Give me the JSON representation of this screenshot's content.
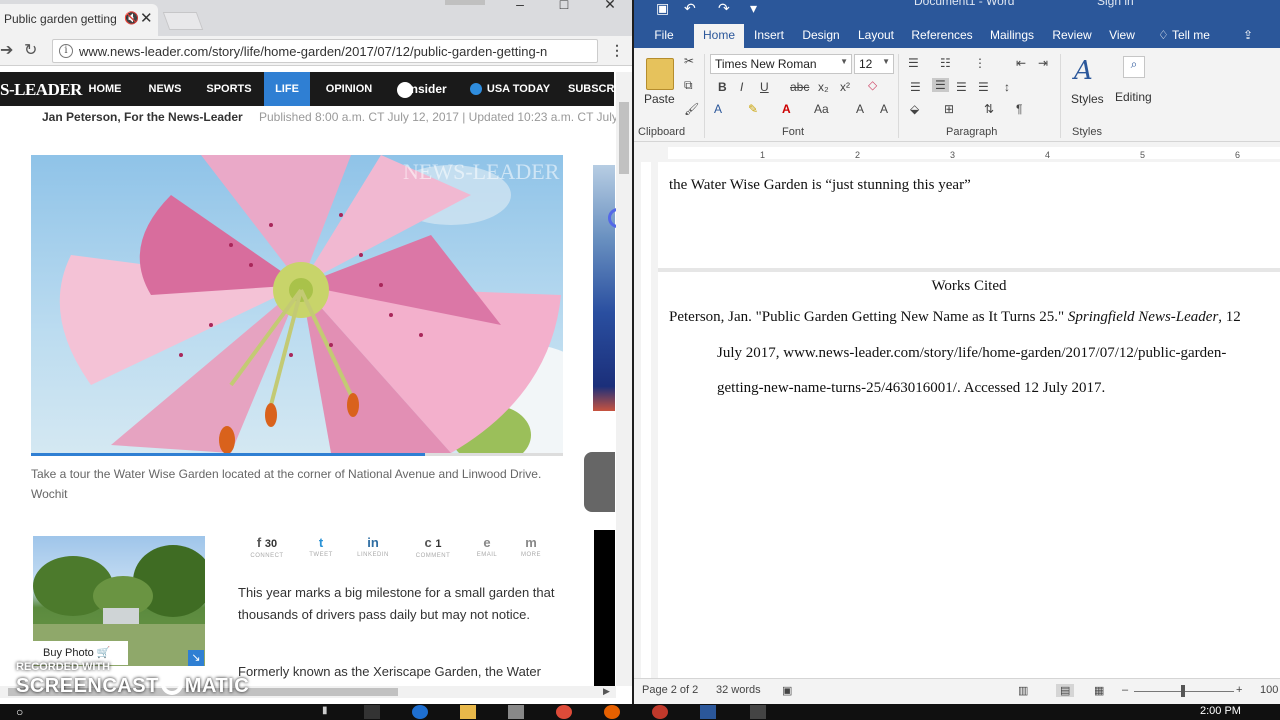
{
  "browser": {
    "tab_title": "Public garden getting",
    "mute_icon": "mute-icon",
    "url": "www.news-leader.com/story/life/home-garden/2017/07/12/public-garden-getting-n",
    "logo": "S-LEADER",
    "nav": [
      "HOME",
      "NEWS",
      "SPORTS",
      "LIFE",
      "OPINION",
      "insider",
      "USA TODAY",
      "SUBSCR"
    ],
    "active_nav": "LIFE",
    "byline": "Jan Peterson, For the News-Leader",
    "published": "Published 8:00 a.m. CT July 12, 2017 | Updated 10:23 a.m. CT July",
    "watermark": "NEWS-LEADER",
    "photo_progress": 0.74,
    "caption": "Take a tour the Water Wise Garden located at the corner of National Avenue and Linwood Drive. Wochit",
    "buy_photo": "Buy Photo",
    "share": [
      {
        "icon": "f",
        "count": "30",
        "label": "CONNECT"
      },
      {
        "icon": "t",
        "count": "",
        "label": "TWEET"
      },
      {
        "icon": "in",
        "count": "",
        "label": "LINKEDIN"
      },
      {
        "icon": "c",
        "count": "1",
        "label": "COMMENT"
      },
      {
        "icon": "e",
        "count": "",
        "label": "EMAIL"
      },
      {
        "icon": "m",
        "count": "",
        "label": "MORE"
      }
    ],
    "body1": "This year marks a big milestone for a small garden that thousands of drivers pass daily but may not notice.",
    "body2": "Formerly known as the Xeriscape Garden, the Water"
  },
  "screencast": {
    "recorded_with": "RECORDED WITH",
    "brand_left": "SCREENCAST",
    "brand_right": "MATIC"
  },
  "word": {
    "title": "Document1 - Word",
    "sign_in": "Sign in",
    "tabs": [
      "File",
      "Home",
      "Insert",
      "Design",
      "Layout",
      "References",
      "Mailings",
      "Review",
      "View",
      "Tell me"
    ],
    "active_tab": "Home",
    "font_name": "Times New Roman",
    "font_size": "12",
    "paste_label": "Paste",
    "styles_label": "Styles",
    "editing_label": "Editing",
    "groups": [
      "Clipboard",
      "Font",
      "Paragraph",
      "Styles"
    ],
    "ruler_numbers": [
      "1",
      "2",
      "3",
      "4",
      "5",
      "6"
    ],
    "page1_line": "the Water Wise Garden is “just stunning this year”",
    "works_cited": "Works Cited",
    "citation_line1_a": "Peterson, Jan. \"Public Garden Getting New Name as It Turns 25.\" ",
    "citation_line1_italic": "Springfield News-Leader",
    "citation_line1_b": ", 12",
    "citation_line2": "July 2017, www.news-leader.com/story/life/home-garden/2017/07/12/public-garden-",
    "citation_line3": "getting-new-name-turns-25/463016001/. Accessed 12 July 2017.",
    "status_page": "Page 2 of 2",
    "status_words": "32 words",
    "zoom": "100"
  },
  "taskbar": {
    "time": "2:00 PM"
  }
}
